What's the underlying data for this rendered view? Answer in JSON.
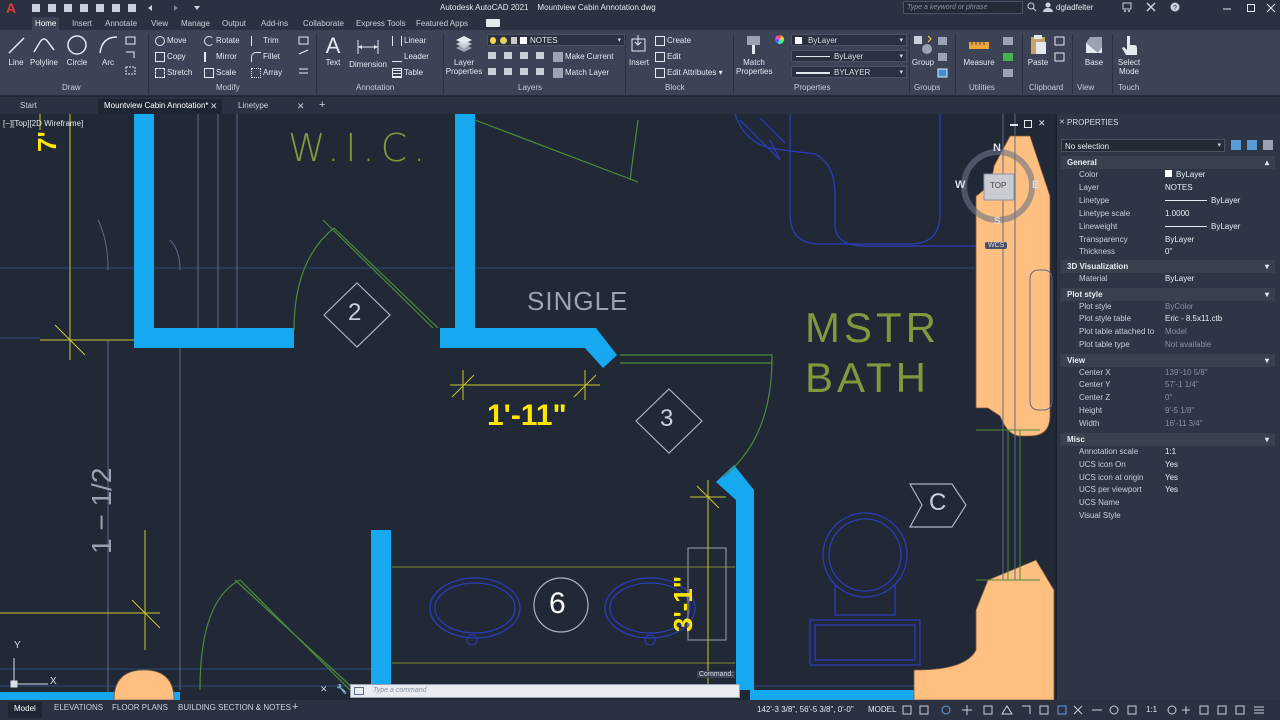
{
  "app": {
    "title": "Autodesk AutoCAD 2021",
    "file": "Mountview Cabin Annotation.dwg",
    "search_placeholder": "Type a keyword or phrase",
    "user": "dgladfelter"
  },
  "ribbon_tabs": [
    "Home",
    "Insert",
    "Annotate",
    "View",
    "Manage",
    "Output",
    "Add-ins",
    "Collaborate",
    "Express Tools",
    "Featured Apps"
  ],
  "ribbon": {
    "draw": {
      "label": "Draw",
      "line": "Line",
      "polyline": "Polyline",
      "circle": "Circle",
      "arc": "Arc"
    },
    "modify": {
      "label": "Modify",
      "move": "Move",
      "rotate": "Rotate",
      "trim": "Trim",
      "copy": "Copy",
      "mirror": "Mirror",
      "fillet": "Fillet",
      "stretch": "Stretch",
      "scale": "Scale",
      "array": "Array"
    },
    "annotation": {
      "label": "Annotation",
      "text": "Text",
      "dimension": "Dimension",
      "linear": "Linear",
      "leader": "Leader",
      "table": "Table"
    },
    "layers": {
      "label": "Layers",
      "layer_properties": "Layer Properties",
      "current_layer": "NOTES",
      "make_current": "Make Current",
      "match_layer": "Match Layer"
    },
    "block": {
      "label": "Block",
      "insert": "Insert",
      "create": "Create",
      "edit": "Edit",
      "edit_attributes": "Edit Attributes"
    },
    "properties": {
      "label": "Properties",
      "match_properties": "Match Properties",
      "color": "ByLayer",
      "linetype": "ByLayer",
      "lineweight": "BYLAYER"
    },
    "groups": {
      "label": "Groups",
      "group": "Group"
    },
    "utilities": {
      "label": "Utilities",
      "measure": "Measure"
    },
    "clipboard": {
      "label": "Clipboard",
      "paste": "Paste"
    },
    "view": {
      "label": "View",
      "base": "Base"
    },
    "touch": {
      "label": "Touch",
      "select_mode": "Select Mode"
    }
  },
  "doc_tabs": [
    "Start",
    "Mountview Cabin Annotation*",
    "Linetype"
  ],
  "viewport": {
    "label": "[−][Top][2D Wireframe]",
    "viewcube": {
      "n": "N",
      "w": "W",
      "e": "E",
      "s": "S",
      "top": "TOP",
      "wcs": "WCS"
    },
    "rooms": [
      "W.I.C.",
      "SINGLE",
      "MSTR",
      "BATH"
    ],
    "tags": [
      "2",
      "3",
      "6",
      "C"
    ],
    "dims": [
      "1'-11\"",
      "1 − 1/2",
      "3'-1\"",
      "7'"
    ],
    "ucs": {
      "x": "X",
      "y": "Y"
    }
  },
  "command": {
    "placeholder": "Type a command",
    "tooltip": "Command:"
  },
  "properties_panel": {
    "title": "PROPERTIES",
    "selection": "No selection",
    "sections": [
      {
        "name": "General",
        "rows": [
          {
            "k": "Color",
            "v": "ByLayer"
          },
          {
            "k": "Layer",
            "v": "NOTES"
          },
          {
            "k": "Linetype",
            "v": "ByLayer"
          },
          {
            "k": "Linetype scale",
            "v": "1.0000"
          },
          {
            "k": "Lineweight",
            "v": "ByLayer"
          },
          {
            "k": "Transparency",
            "v": "ByLayer"
          },
          {
            "k": "Thickness",
            "v": "0\""
          }
        ]
      },
      {
        "name": "3D Visualization",
        "rows": [
          {
            "k": "Material",
            "v": "ByLayer"
          }
        ]
      },
      {
        "name": "Plot style",
        "rows": [
          {
            "k": "Plot style",
            "v": "ByColor"
          },
          {
            "k": "Plot style table",
            "v": "Eric - 8.5x11.ctb"
          },
          {
            "k": "Plot table attached to",
            "v": "Model"
          },
          {
            "k": "Plot table type",
            "v": "Not available"
          }
        ]
      },
      {
        "name": "View",
        "rows": [
          {
            "k": "Center X",
            "v": "139'-10 5/8\""
          },
          {
            "k": "Center Y",
            "v": "57'-1 1/4\""
          },
          {
            "k": "Center Z",
            "v": "0\""
          },
          {
            "k": "Height",
            "v": "9'-5 1/8\""
          },
          {
            "k": "Width",
            "v": "16'-11 3/4\""
          }
        ]
      },
      {
        "name": "Misc",
        "rows": [
          {
            "k": "Annotation scale",
            "v": "1:1"
          },
          {
            "k": "UCS icon On",
            "v": "Yes"
          },
          {
            "k": "UCS icon at origin",
            "v": "Yes"
          },
          {
            "k": "UCS per viewport",
            "v": "Yes"
          },
          {
            "k": "UCS Name",
            "v": ""
          },
          {
            "k": "Visual Style",
            "v": ""
          }
        ]
      }
    ]
  },
  "status": {
    "layout_tabs": [
      "Model",
      "ELEVATIONS",
      "FLOOR PLANS",
      "BUILDING SECTION & NOTES"
    ],
    "coords": "142'-3 3/8\", 56'-5 3/8\", 0'-0\"",
    "mode": "MODEL",
    "scale": "1:1"
  },
  "colors": {
    "wall": "#16a9ef",
    "text_green": "#7d9a3c",
    "text_yellow": "#ffe600",
    "dim_yellow": "#c9c92a",
    "fixture_blue": "#2c3cb8",
    "brick": "#ffbf80",
    "bg": "#212836"
  }
}
